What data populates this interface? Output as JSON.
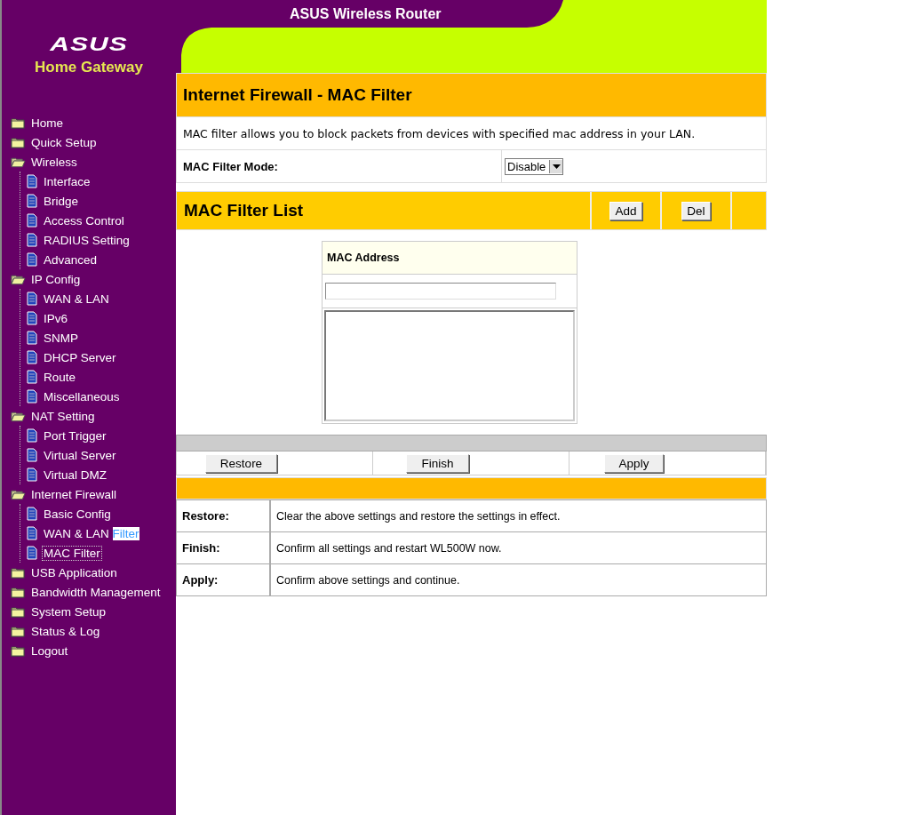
{
  "sidebar": {
    "logo": "ASUS",
    "subtitle": "Home Gateway",
    "menu": [
      {
        "label": "Home",
        "expanded": false
      },
      {
        "label": "Quick Setup",
        "expanded": false
      },
      {
        "label": "Wireless",
        "expanded": true,
        "children": [
          {
            "label": "Interface",
            "focused": false
          },
          {
            "label": "Bridge",
            "focused": false
          },
          {
            "label": "Access Control",
            "focused": false
          },
          {
            "label": "RADIUS Setting",
            "focused": false
          },
          {
            "label": "Advanced",
            "focused": false
          }
        ]
      },
      {
        "label": "IP Config",
        "expanded": true,
        "children": [
          {
            "label": "WAN & LAN",
            "focused": false
          },
          {
            "label": "IPv6",
            "focused": false
          },
          {
            "label": "SNMP",
            "focused": false
          },
          {
            "label": "DHCP Server",
            "focused": false
          },
          {
            "label": "Route",
            "focused": false
          },
          {
            "label": "Miscellaneous",
            "focused": false
          }
        ]
      },
      {
        "label": "NAT Setting",
        "expanded": true,
        "children": [
          {
            "label": "Port Trigger",
            "focused": false
          },
          {
            "label": "Virtual Server",
            "focused": false
          },
          {
            "label": "Virtual DMZ",
            "focused": false
          }
        ]
      },
      {
        "label": "Internet Firewall",
        "expanded": true,
        "children": [
          {
            "label": "Basic Config",
            "focused": false
          },
          {
            "label": "WAN & LAN",
            "highlighted_text": "Filter",
            "focused": false
          },
          {
            "label": "MAC Filter",
            "focused": true
          }
        ]
      },
      {
        "label": "USB Application",
        "expanded": false
      },
      {
        "label": "Bandwidth Management",
        "expanded": false
      },
      {
        "label": "System Setup",
        "expanded": false
      },
      {
        "label": "Status & Log",
        "expanded": false
      },
      {
        "label": "Logout",
        "expanded": false
      }
    ]
  },
  "header": {
    "title": "ASUS Wireless Router"
  },
  "page": {
    "title": "Internet Firewall - MAC Filter",
    "description": "MAC filter allows you to block packets from devices with specified mac address in your LAN.",
    "mode": {
      "label": "MAC Filter Mode:",
      "value": "Disable"
    }
  },
  "filter_list": {
    "title": "MAC Filter List",
    "buttons": [
      "Add",
      "Del"
    ],
    "column": "MAC Address"
  },
  "actions": [
    "Restore",
    "Finish",
    "Apply"
  ],
  "help": [
    {
      "term": "Restore:",
      "text": "Clear the above settings and restore the settings in effect."
    },
    {
      "term": "Finish:",
      "text": "Confirm all settings and restart WL500W now."
    },
    {
      "term": "Apply:",
      "text": "Confirm above settings and continue."
    }
  ]
}
